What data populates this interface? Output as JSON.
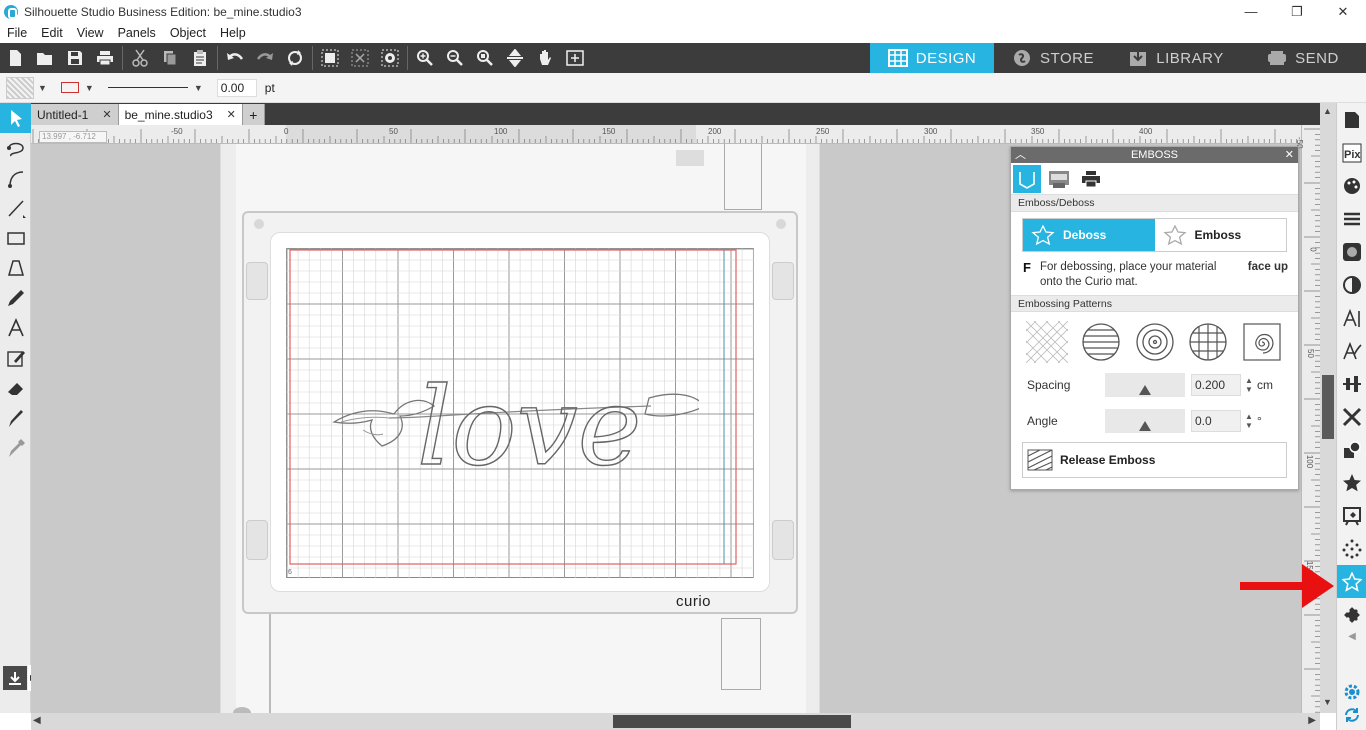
{
  "window": {
    "title": "Silhouette Studio Business Edition: be_mine.studio3",
    "min": "—",
    "max": "❐",
    "close": "✕"
  },
  "menu": [
    "File",
    "Edit",
    "View",
    "Panels",
    "Object",
    "Help"
  ],
  "nav_tabs": [
    {
      "label": "DESIGN",
      "icon": "grid-icon",
      "active": true
    },
    {
      "label": "STORE",
      "icon": "store-icon",
      "active": false
    },
    {
      "label": "LIBRARY",
      "icon": "library-icon",
      "active": false
    },
    {
      "label": "SEND",
      "icon": "send-icon",
      "active": false
    }
  ],
  "propbar": {
    "line_width": "0.00",
    "unit": "pt"
  },
  "doc_tabs": [
    {
      "label": "Untitled-1",
      "active": false
    },
    {
      "label": "be_mine.studio3",
      "active": true
    }
  ],
  "doc_tabs_add": "+",
  "ruler": {
    "coords": "13.997 , -6.712",
    "top_labels": [
      "-50",
      "0",
      "50",
      "100",
      "150",
      "200",
      "250",
      "300",
      "350",
      "400"
    ],
    "right_labels": [
      "-50",
      "0",
      "50",
      "100",
      "150"
    ]
  },
  "mat": {
    "brand": "curio",
    "corner_mark": "6"
  },
  "design_text": "love",
  "emboss_panel": {
    "title": "EMBOSS",
    "section1": "Emboss/Deboss",
    "deboss_label": "Deboss",
    "emboss_label": "Emboss",
    "note_letter": "F",
    "note_text_1": "For debossing, place your material ",
    "note_bold": "face up",
    "note_text_2": "onto the Curio mat.",
    "section2": "Embossing Patterns",
    "spacing_label": "Spacing",
    "spacing_value": "0.200",
    "spacing_unit": "cm",
    "angle_label": "Angle",
    "angle_value": "0.0",
    "angle_unit": "°",
    "release_label": "Release Emboss"
  },
  "colors": {
    "accent": "#27b4e0",
    "toolbar": "#3c3c3c",
    "arrow": "#e81010",
    "grid_red": "#e06060"
  }
}
